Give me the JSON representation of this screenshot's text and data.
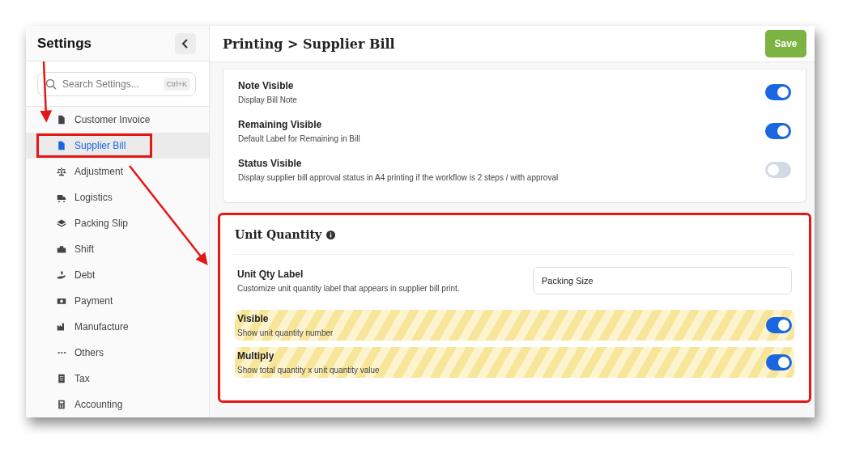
{
  "sidebar": {
    "title": "Settings",
    "search": {
      "placeholder": "Search Settings...",
      "shortcut": "Ctrl+K"
    },
    "items": [
      {
        "label": "Customer Invoice",
        "selected": false,
        "annotated": false
      },
      {
        "label": "Supplier Bill",
        "selected": true,
        "annotated": true
      },
      {
        "label": "Adjustment",
        "selected": false,
        "annotated": false
      },
      {
        "label": "Logistics",
        "selected": false,
        "annotated": false
      },
      {
        "label": "Packing Slip",
        "selected": false,
        "annotated": false
      },
      {
        "label": "Shift",
        "selected": false,
        "annotated": false
      },
      {
        "label": "Debt",
        "selected": false,
        "annotated": false
      },
      {
        "label": "Payment",
        "selected": false,
        "annotated": false
      },
      {
        "label": "Manufacture",
        "selected": false,
        "annotated": false
      },
      {
        "label": "Others",
        "selected": false,
        "annotated": false
      },
      {
        "label": "Tax",
        "selected": false,
        "annotated": false
      },
      {
        "label": "Accounting",
        "selected": false,
        "annotated": false
      }
    ]
  },
  "header": {
    "title": "Printing > Supplier Bill",
    "save": "Save"
  },
  "print_card": {
    "settings": [
      {
        "kind": "toggle",
        "label": "Note Visible",
        "description": "Display Bill Note",
        "on": true,
        "highlighted": false
      },
      {
        "kind": "toggle",
        "label": "Remaining Visible",
        "description": "Default Label for Remaining in Bill",
        "on": true,
        "highlighted": false
      },
      {
        "kind": "toggle",
        "label": "Status Visible",
        "description": "Display supplier bill approval status in A4 printing if the workflow is 2 steps / with approval",
        "on": false,
        "highlighted": false
      }
    ]
  },
  "unit_card": {
    "title": "Unit Quantity",
    "annotated": true,
    "settings": [
      {
        "kind": "input",
        "label": "Unit Qty Label",
        "description": "Customize unit quantity label that appears in supplier bill print.",
        "value": "Packing Size",
        "highlighted": false
      },
      {
        "kind": "toggle",
        "label": "Visible",
        "description": "Show unit quantity number",
        "on": true,
        "highlighted": true
      },
      {
        "kind": "toggle",
        "label": "Multiply",
        "description": "Show total quantity x unit quantity value",
        "on": true,
        "highlighted": true
      }
    ]
  }
}
